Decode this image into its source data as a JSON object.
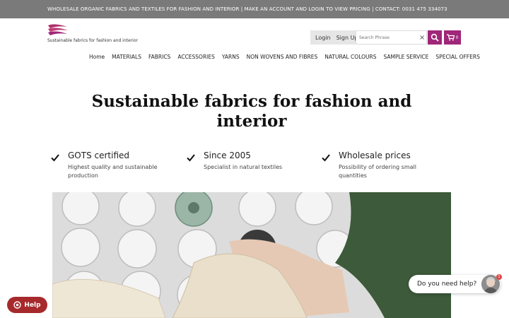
{
  "topbar": {
    "text": "WHOLESALE ORGANIC FABRICS AND TEXTILES FOR FASHION AND INTERIOR | MAKE AN ACCOUNT AND LOGIN TO VIEW PRICING | CONTACT: 0031 475 334073"
  },
  "header": {
    "tagline": "Sustainable fabrics for fashion and interior",
    "login_label": "Login",
    "signup_label": "Sign Up",
    "search_placeholder": "Search Phrase",
    "clear_label": "×",
    "cart_count": "0",
    "accent_color": "#a0267a"
  },
  "nav": {
    "items": [
      "Home",
      "MATERIALS",
      "FABRICS",
      "ACCESSORIES",
      "YARNS",
      "NON WOVENS AND FIBRES",
      "NATURAL COLOURS",
      "SAMPLE SERVICE",
      "SPECIAL OFFERS"
    ]
  },
  "hero": {
    "title": "Sustainable fabrics for fashion and interior"
  },
  "features": [
    {
      "title": "GOTS certified",
      "desc": "Highest quality and sustainable production"
    },
    {
      "title": "Since 2005",
      "desc": "Specialist in natural textiles"
    },
    {
      "title": "Wholesale prices",
      "desc": "Possibility of ordering small quantities"
    }
  ],
  "widgets": {
    "help_label": "Help",
    "chat_label": "Do you need help?",
    "chat_badge": "1"
  }
}
